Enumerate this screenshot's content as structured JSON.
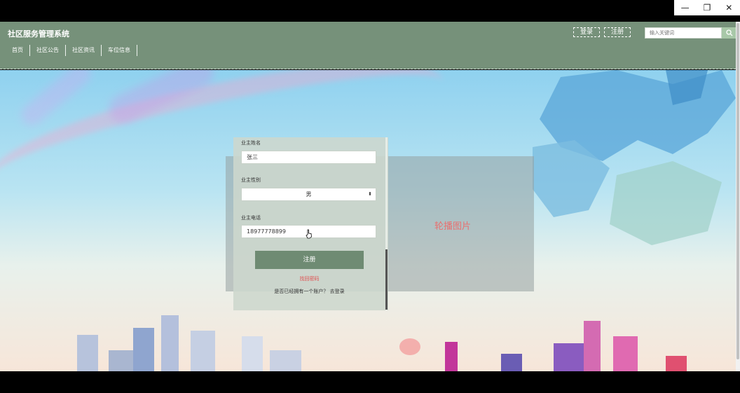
{
  "window": {
    "minimize_glyph": "—",
    "maximize_glyph": "❐",
    "close_glyph": "✕"
  },
  "header": {
    "brand": "社区服务管理系统",
    "login_label": "登录",
    "register_label": "注册",
    "search_placeholder": "输入关键词"
  },
  "nav": {
    "items": [
      {
        "label": "首页"
      },
      {
        "label": "社区公告"
      },
      {
        "label": "社区资讯"
      },
      {
        "label": "车位信息"
      }
    ]
  },
  "slideshow": {
    "text": "轮播图片"
  },
  "form": {
    "owner_name_label": "业主姓名",
    "owner_name_value": "张三",
    "owner_gender_label": "业主性别",
    "owner_gender_value": "男",
    "owner_phone_label": "业主电话",
    "owner_phone_value": "18977778899",
    "submit_label": "注册",
    "forgot_label": "找回密码",
    "login_prompt": "是否已经拥有一个账户？ 去登录"
  },
  "colors": {
    "header_bg": "#76917a",
    "button_bg": "#6f8b73",
    "link_red": "#e05050"
  },
  "icons": {
    "search": "search-icon",
    "select": "chevron-updown-icon",
    "cursor": "hand-pointer-icon"
  }
}
